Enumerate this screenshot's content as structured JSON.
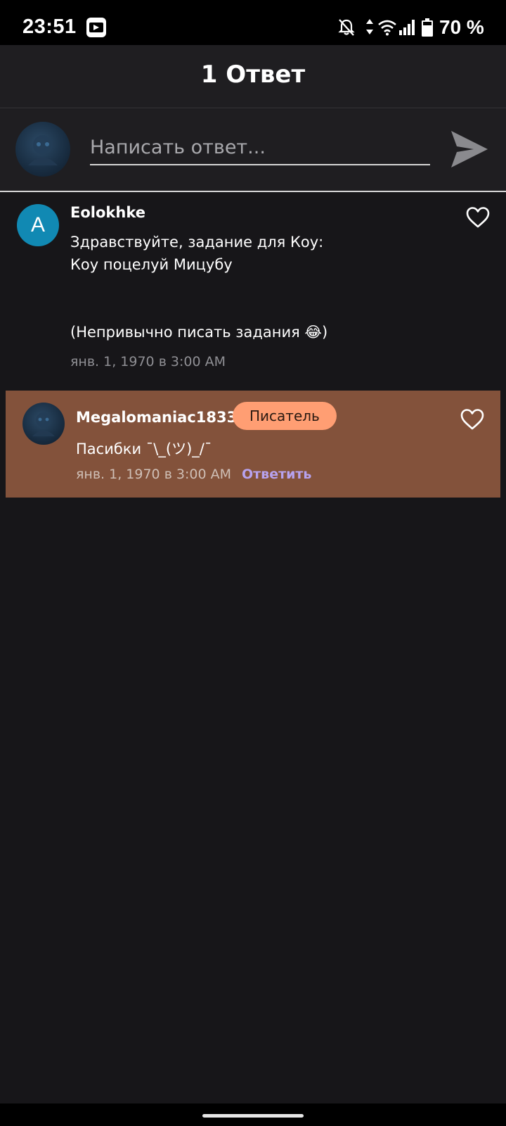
{
  "status_bar": {
    "time": "23:51",
    "battery": "70 %",
    "icons": [
      "app-notification-icon",
      "bell-off-icon",
      "data-arrows-icon",
      "wifi-icon",
      "signal-icon",
      "battery-icon"
    ]
  },
  "header": {
    "title": "1 Ответ"
  },
  "composer": {
    "placeholder": "Написать ответ...",
    "send_icon": "send-icon"
  },
  "comments": [
    {
      "avatar_letter": "A",
      "avatar_color": "#1189b3",
      "username": "Eolokhke",
      "lines": [
        "Здравствуйте, задание для Коу:",
        "Коу поцелуй Мицубу",
        "",
        "",
        "(Непривычно писать задания 😂)"
      ],
      "time": "янв. 1, 1970 в 3:00 AM"
    },
    {
      "username": "Megalomaniac1833",
      "role": "Писатель",
      "text": "Пасибки ¯\\_(ツ)_/¯",
      "time": "янв. 1, 1970 в 3:00 AM",
      "reply_label": "Ответить",
      "highlight_color": "#83523b",
      "badge_color": "#ff9e73",
      "reply_color": "#b7a2ee"
    }
  ]
}
